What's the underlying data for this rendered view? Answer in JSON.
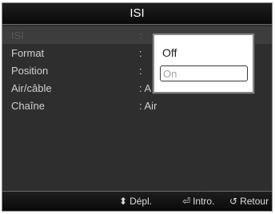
{
  "window": {
    "title": "ISI"
  },
  "menu": {
    "items": [
      {
        "label": "ISI",
        "value": ":"
      },
      {
        "label": "Format",
        "value": ":"
      },
      {
        "label": "Position",
        "value": ":"
      },
      {
        "label": "Air/câble",
        "value": ": Air"
      },
      {
        "label": "Chaîne",
        "value": ": Air"
      }
    ]
  },
  "popup": {
    "options": [
      "Off",
      "On"
    ],
    "selected": "On"
  },
  "footer": {
    "move": {
      "icon": "up-down-arrow-icon",
      "glyph": "⬍",
      "label": "Dépl."
    },
    "enter": {
      "icon": "enter-icon",
      "glyph": "⏎",
      "label": "Intro."
    },
    "return": {
      "icon": "return-icon",
      "glyph": "↺",
      "label": "Retour"
    }
  }
}
